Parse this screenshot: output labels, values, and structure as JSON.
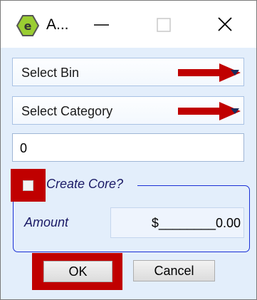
{
  "window": {
    "title": "A...",
    "app_icon": "green-e-icon",
    "controls": {
      "minimize": "minimize-icon",
      "maximize": "maximize-icon",
      "close": "close-icon"
    }
  },
  "form": {
    "bin_select": {
      "value": "Select Bin",
      "icon": "chevron-down-icon"
    },
    "category_select": {
      "value": "Select Category",
      "icon": "chevron-down-icon"
    },
    "quantity_input": {
      "value": "0"
    },
    "create_core": {
      "label": "Create Core?",
      "checked": false
    },
    "amount": {
      "label": "Amount",
      "value": "$________0.00"
    }
  },
  "buttons": {
    "ok": "OK",
    "cancel": "Cancel"
  },
  "annotations": {
    "arrow_color": "#c00000",
    "highlight_color": "#c00000"
  }
}
